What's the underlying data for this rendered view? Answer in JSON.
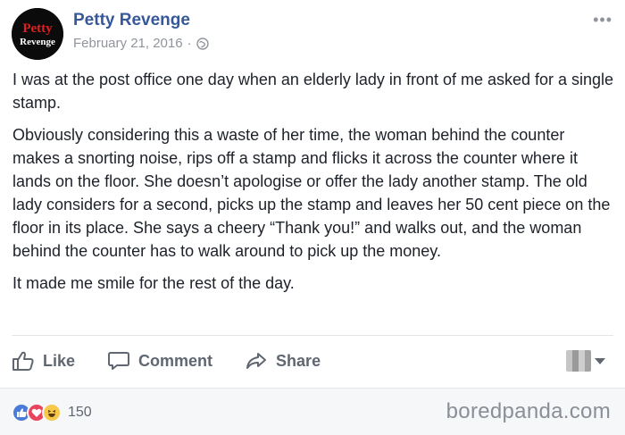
{
  "page": {
    "name": "Petty Revenge",
    "date": "February 21, 2016",
    "separator": "·",
    "logo_text_line1": "Petty",
    "logo_text_line2": "Revenge"
  },
  "post": {
    "paragraphs": [
      "I was at the post office one day when an elderly lady in front of me asked for a single stamp.",
      "Obviously considering this a waste of her time, the woman behind the counter makes a snorting noise, rips off a stamp and flicks it across the counter where it lands on the floor. She doesn’t apologise or offer the lady another stamp. The old lady considers for a second, picks up the stamp and leaves her 50 cent piece on the floor in its place. She says a cheery “Thank you!” and walks out, and the woman behind the counter has to walk around to pick up the money.",
      "It made me smile for the rest of the day."
    ]
  },
  "actions": {
    "like": "Like",
    "comment": "Comment",
    "share": "Share"
  },
  "footer": {
    "reaction_count": "150",
    "watermark": "boredpanda.com"
  },
  "icons": {
    "globe": "globe-icon",
    "more": "more-options-icon",
    "like": "thumbs-up-icon",
    "comment": "speech-bubble-icon",
    "share": "share-arrow-icon"
  },
  "colors": {
    "name_link": "#365899",
    "meta_gray": "#90949c",
    "action_gray": "#606770",
    "like_blue": "#4a7bd8",
    "love_red": "#e9455c",
    "haha_yellow": "#f7c94a",
    "logo_red": "#e02020"
  }
}
